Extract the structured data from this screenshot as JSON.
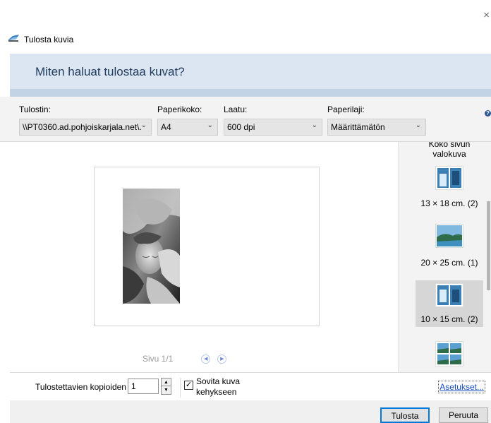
{
  "window": {
    "title": "Tulosta kuvia",
    "close_glyph": "×",
    "icon": "print-pictures-icon"
  },
  "banner": {
    "heading": "Miten haluat tulostaa kuvat?"
  },
  "options": {
    "printer": {
      "label": "Tulostin:",
      "value": "\\\\PT0360.ad.pohjoiskarjala.net\\."
    },
    "paper_size": {
      "label": "Paperikoko:",
      "value": "A4"
    },
    "quality": {
      "label": "Laatu:",
      "value": "600 dpi"
    },
    "paper_type": {
      "label": "Paperilaji:",
      "value": "Määrittämätön"
    }
  },
  "preview": {
    "image": "grayscale photo of sleeping child",
    "pager_text": "Sivu 1/1",
    "prev_icon": "previous-page-icon",
    "next_icon": "next-page-icon"
  },
  "layouts": {
    "header": "Koko sivun valokuva",
    "items": [
      {
        "caption": "13 × 18 cm. (2)",
        "selected": false
      },
      {
        "caption": "20 × 25 cm. (1)",
        "selected": false
      },
      {
        "caption": "10 × 15 cm. (2)",
        "selected": true
      },
      {
        "caption": "",
        "selected": false
      }
    ]
  },
  "footer": {
    "copies_label": "Tulostettavien kopioiden",
    "copies_value": "1",
    "fit_label": "Sovita kuva kehykseen",
    "fit_checked": true,
    "settings_link": "Asetukset..."
  },
  "buttons": {
    "print": "Tulosta",
    "cancel": "Peruuta"
  },
  "colors": {
    "banner": "#dbe6f2",
    "accent": "#0078d7",
    "link": "#1a4fbf"
  }
}
